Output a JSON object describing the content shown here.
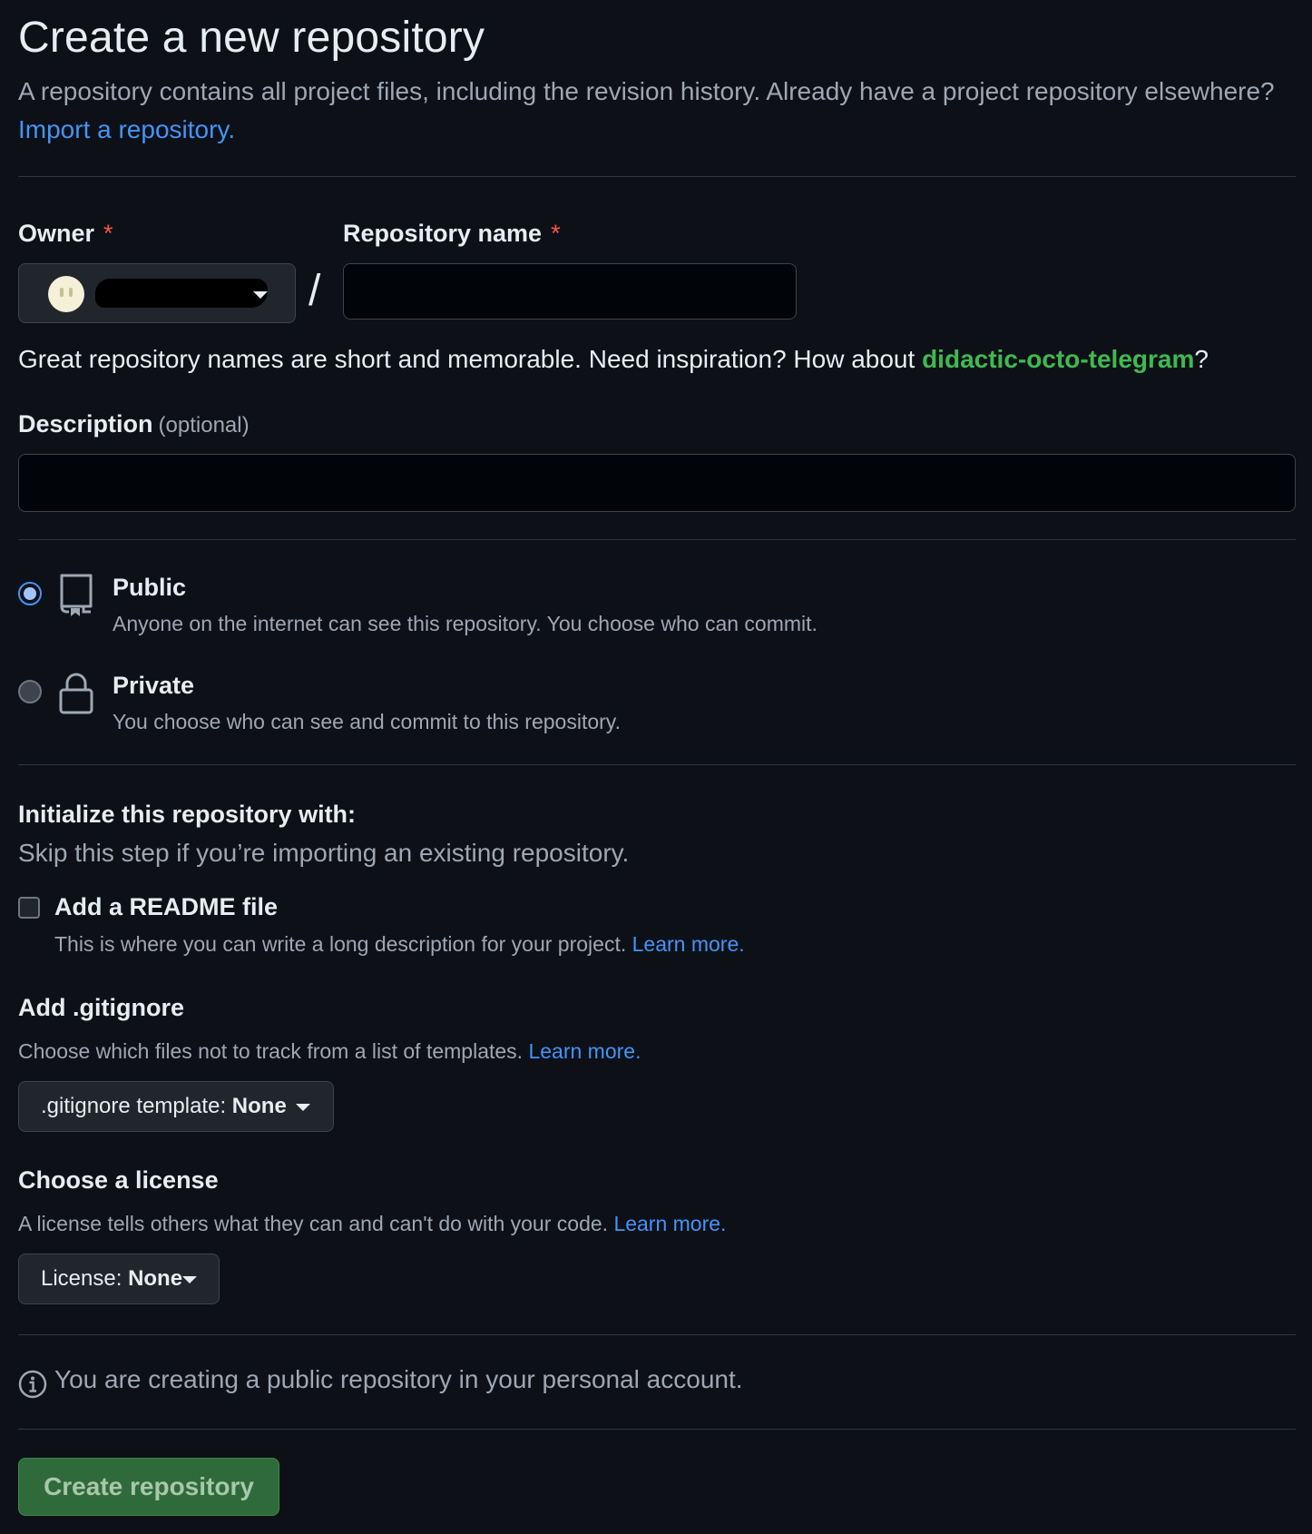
{
  "header": {
    "title": "Create a new repository",
    "subtitle": "A repository contains all project files, including the revision history. Already have a project repository elsewhere?",
    "import_link": "Import a repository."
  },
  "owner": {
    "label": "Owner",
    "required_mark": "*"
  },
  "repo_name": {
    "label": "Repository name",
    "required_mark": "*",
    "separator": "/",
    "value": ""
  },
  "name_hint": {
    "text": "Great repository names are short and memorable. Need inspiration? How about ",
    "suggestion": "didactic-octo-telegram",
    "suffix": "?"
  },
  "description": {
    "label": "Description",
    "optional": "(optional)",
    "value": ""
  },
  "visibility": {
    "selected": "public",
    "options": [
      {
        "title": "Public",
        "desc": "Anyone on the internet can see this repository. You choose who can commit."
      },
      {
        "title": "Private",
        "desc": "You choose who can see and commit to this repository."
      }
    ]
  },
  "initialize": {
    "title": "Initialize this repository with:",
    "skip": "Skip this step if you’re importing an existing repository.",
    "readme_label": "Add a README file",
    "readme_desc": "This is where you can write a long description for your project.",
    "readme_checked": false,
    "learn_more": "Learn more."
  },
  "gitignore": {
    "title": "Add .gitignore",
    "desc": "Choose which files not to track from a list of templates.",
    "learn_more": "Learn more.",
    "button_prefix": ".gitignore template: ",
    "button_value": "None"
  },
  "license": {
    "title": "Choose a license",
    "desc": "A license tells others what they can and can't do with your code.",
    "learn_more": "Learn more.",
    "button_prefix": "License: ",
    "button_value": "None"
  },
  "notice": {
    "text": "You are creating a public repository in your personal account."
  },
  "actions": {
    "create_label": "Create repository"
  },
  "colors": {
    "background": "#0d1117",
    "link": "#4493f8",
    "suggestion": "#3fb950",
    "required": "#f85149",
    "create_button": "#2f6b3a"
  }
}
